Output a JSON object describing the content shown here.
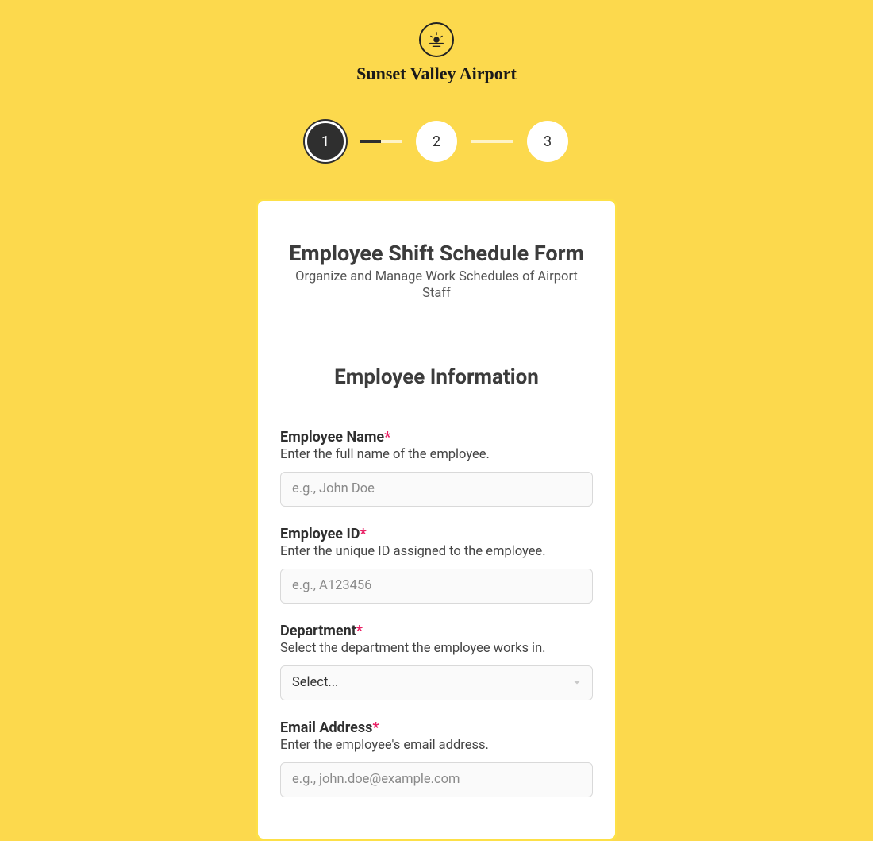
{
  "brand": {
    "title": "Sunset Valley Airport"
  },
  "stepper": {
    "steps": [
      "1",
      "2",
      "3"
    ],
    "active_index": 0
  },
  "form": {
    "title": "Employee Shift Schedule Form",
    "subtitle": "Organize and Manage Work Schedules of Airport Staff",
    "section_title": "Employee Information",
    "required_marker": "*",
    "fields": {
      "name": {
        "label": "Employee Name",
        "help": "Enter the full name of the employee.",
        "placeholder": "e.g., John Doe",
        "value": ""
      },
      "id": {
        "label": "Employee ID",
        "help": "Enter the unique ID assigned to the employee.",
        "placeholder": "e.g., A123456",
        "value": ""
      },
      "department": {
        "label": "Department",
        "help": "Select the department the employee works in.",
        "selected": "Select..."
      },
      "email": {
        "label": "Email Address",
        "help": "Enter the employee's email address.",
        "placeholder": "e.g., john.doe@example.com",
        "value": ""
      }
    }
  }
}
